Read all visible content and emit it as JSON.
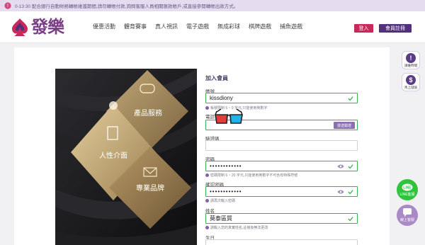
{
  "announcement": {
    "text": "0-13:30 配合銀行自動財務轉帳維護期間,請勿轉帳付款,詢問客服人員相關匯款帳戶,或直接參閱轉帳出款方式。"
  },
  "header": {
    "logo_text": "發樂",
    "nav": [
      "優惠活動",
      "體育賽事",
      "真人視訊",
      "電子遊戲",
      "無成彩球",
      "棋牌遊戲",
      "捕魚遊戲"
    ],
    "login_label": "登入",
    "register_label": "會員註冊"
  },
  "panel": {
    "diamonds": [
      "產品服務",
      "人性介面",
      "專業品牌"
    ]
  },
  "form": {
    "title": "加入會員",
    "account_label": "帳號",
    "account_value": "kissdiony",
    "account_hint": "帳號限制 6 ~ 9 字元,只能使用英數字",
    "phone_label": "電話",
    "phone_value": "",
    "sms_button": "發送驗證",
    "code_label": "驗證碼",
    "code_value": "",
    "password_label": "密碼",
    "password_value": "••••••••••••",
    "password_hint": "密碼限制 6 ~ 20 字元,只能使用英數字不可含有特殊符號",
    "confirm_label": "確認密碼",
    "confirm_value": "••••••••••••",
    "confirm_hint": "請再次輸入密碼",
    "name_label": "姓名",
    "name_value": "莫泰區質",
    "name_hint": "請輸入您的真實姓名,註冊後無法更改",
    "birthday_label": "生日"
  },
  "side": {
    "timeline_label": "請維時間",
    "cash_label": "馬上儲值",
    "line_label": "LINE客服",
    "online_label": "線上客服"
  },
  "colors": {
    "brand_purple": "#52307a",
    "login_red": "#c7295a",
    "success_green": "#37b24d",
    "line_green": "#2fc43b",
    "online_purple": "#a98ac6"
  }
}
